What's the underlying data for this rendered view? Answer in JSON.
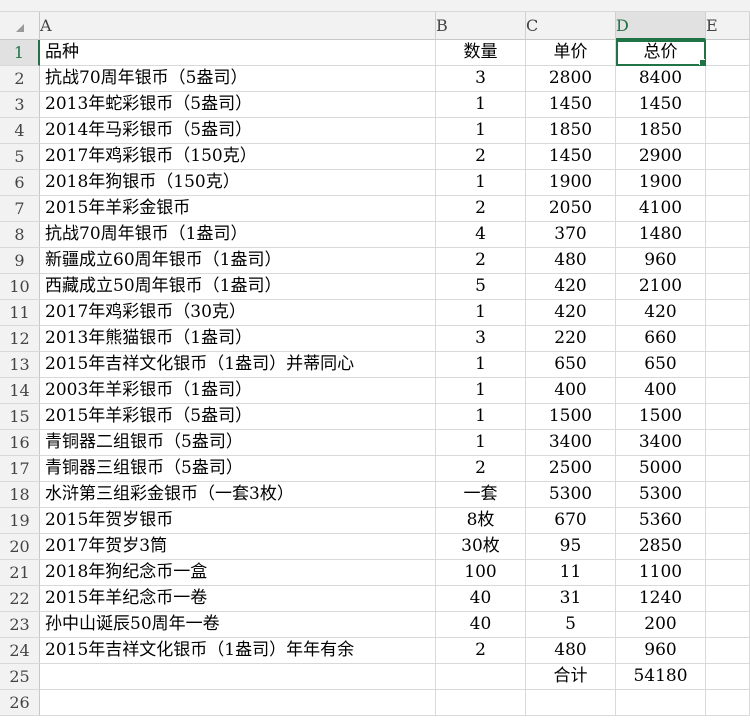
{
  "columns": [
    "A",
    "B",
    "C",
    "D",
    "E"
  ],
  "rows": [
    {
      "num": "1",
      "a": "品种",
      "b": "数量",
      "c": "单价",
      "d": "总价"
    },
    {
      "num": "2",
      "a": "抗战70周年银币（5盎司）",
      "b": "3",
      "c": "2800",
      "d": "8400"
    },
    {
      "num": "3",
      "a": "2013年蛇彩银币（5盎司）",
      "b": "1",
      "c": "1450",
      "d": "1450"
    },
    {
      "num": "4",
      "a": "2014年马彩银币（5盎司）",
      "b": "1",
      "c": "1850",
      "d": "1850"
    },
    {
      "num": "5",
      "a": "2017年鸡彩银币（150克）",
      "b": "2",
      "c": "1450",
      "d": "2900"
    },
    {
      "num": "6",
      "a": "2018年狗银币（150克）",
      "b": "1",
      "c": "1900",
      "d": "1900"
    },
    {
      "num": "7",
      "a": "2015年羊彩金银币",
      "b": "2",
      "c": "2050",
      "d": "4100"
    },
    {
      "num": "8",
      "a": "抗战70周年银币（1盎司）",
      "b": "4",
      "c": "370",
      "d": "1480"
    },
    {
      "num": "9",
      "a": "新疆成立60周年银币（1盎司）",
      "b": "2",
      "c": "480",
      "d": "960"
    },
    {
      "num": "10",
      "a": "西藏成立50周年银币（1盎司）",
      "b": "5",
      "c": "420",
      "d": "2100"
    },
    {
      "num": "11",
      "a": "2017年鸡彩银币（30克）",
      "b": "1",
      "c": "420",
      "d": "420"
    },
    {
      "num": "12",
      "a": "2013年熊猫银币（1盎司）",
      "b": "3",
      "c": "220",
      "d": "660"
    },
    {
      "num": "13",
      "a": "2015年吉祥文化银币（1盎司）并蒂同心",
      "b": "1",
      "c": "650",
      "d": "650"
    },
    {
      "num": "14",
      "a": "2003年羊彩银币（1盎司）",
      "b": "1",
      "c": "400",
      "d": "400"
    },
    {
      "num": "15",
      "a": "2015年羊彩银币（5盎司）",
      "b": "1",
      "c": "1500",
      "d": "1500"
    },
    {
      "num": "16",
      "a": "青铜器二组银币（5盎司）",
      "b": "1",
      "c": "3400",
      "d": "3400"
    },
    {
      "num": "17",
      "a": "青铜器三组银币（5盎司）",
      "b": "2",
      "c": "2500",
      "d": "5000"
    },
    {
      "num": "18",
      "a": "水浒第三组彩金银币（一套3枚）",
      "b": "一套",
      "c": "5300",
      "d": "5300"
    },
    {
      "num": "19",
      "a": "2015年贺岁银币",
      "b": "8枚",
      "c": "670",
      "d": "5360"
    },
    {
      "num": "20",
      "a": "2017年贺岁3筒",
      "b": "30枚",
      "c": "95",
      "d": "2850"
    },
    {
      "num": "21",
      "a": "2018年狗纪念币一盒",
      "b": "100",
      "c": "11",
      "d": "1100"
    },
    {
      "num": "22",
      "a": "2015年羊纪念币一卷",
      "b": "40",
      "c": "31",
      "d": "1240"
    },
    {
      "num": "23",
      "a": "孙中山诞辰50周年一卷",
      "b": "40",
      "c": "5",
      "d": "200"
    },
    {
      "num": "24",
      "a": "2015年吉祥文化银币（1盎司）年年有余",
      "b": "2",
      "c": "480",
      "d": "960"
    },
    {
      "num": "25",
      "a": "",
      "b": "",
      "c": "合计",
      "d": "54180"
    },
    {
      "num": "26",
      "a": "",
      "b": "",
      "c": "",
      "d": ""
    }
  ],
  "selected_cell": "D1",
  "accent_color": "#217346",
  "icons": {
    "corner": "select-all-triangle-icon"
  }
}
